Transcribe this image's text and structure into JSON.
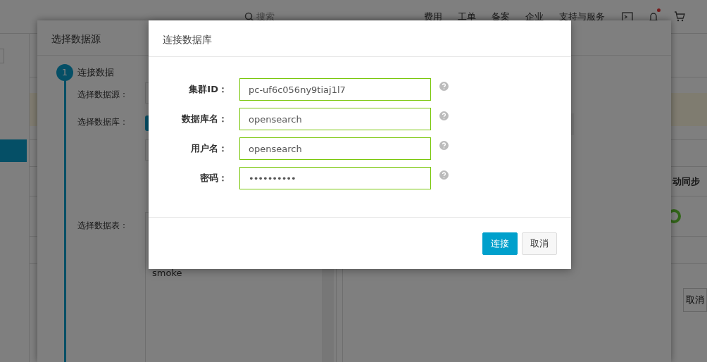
{
  "top_nav": {
    "search_placeholder": "搜索",
    "items": [
      "费用",
      "工单",
      "备案",
      "企业",
      "支持与服务"
    ],
    "has_notification": true
  },
  "source_dialog": {
    "title": "选择数据源",
    "step": {
      "number": "1",
      "label": "连接数据"
    },
    "fields": [
      {
        "label": "选择数据源："
      },
      {
        "label": "选择数据库："
      },
      {
        "label": "选择数据表："
      }
    ],
    "tables": [
      "smoke"
    ]
  },
  "background": {
    "sync_label": "动同步",
    "sync_on": true,
    "cancel_button": "取消"
  },
  "modal": {
    "title": "连接数据库",
    "fields": [
      {
        "label": "集群ID：",
        "value": "pc-uf6c056ny9tiaj1l7",
        "kind": "text"
      },
      {
        "label": "数据库名：",
        "value": "opensearch",
        "kind": "text"
      },
      {
        "label": "用户名：",
        "value": "opensearch",
        "kind": "text"
      },
      {
        "label": "密码：",
        "value": "••••••••••",
        "kind": "password"
      }
    ],
    "buttons": [
      {
        "label": "连接",
        "primary": true
      },
      {
        "label": "取消",
        "primary": false
      }
    ]
  }
}
